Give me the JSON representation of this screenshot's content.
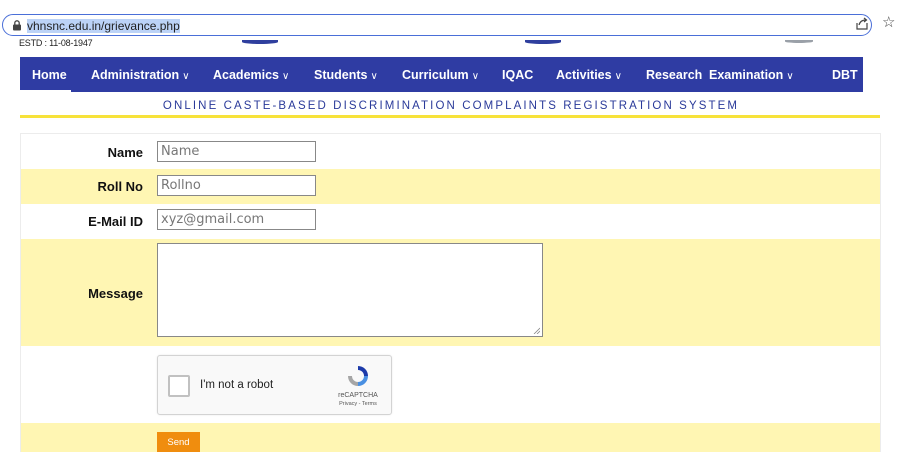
{
  "browser": {
    "url": "vhnsnc.edu.in/grievance.php"
  },
  "header": {
    "estd": "ESTD : 11-08-1947"
  },
  "nav": {
    "items": [
      {
        "label": "Home",
        "dropdown": false
      },
      {
        "label": "Administration",
        "dropdown": true
      },
      {
        "label": "Academics",
        "dropdown": true
      },
      {
        "label": "Students",
        "dropdown": true
      },
      {
        "label": "Curriculum",
        "dropdown": true
      },
      {
        "label": "IQAC",
        "dropdown": false
      },
      {
        "label": "Activities",
        "dropdown": true
      },
      {
        "label": "Research",
        "dropdown": false
      },
      {
        "label": "Examination",
        "dropdown": true
      },
      {
        "label": "DBT",
        "dropdown": false
      }
    ],
    "chevron": "∨"
  },
  "page": {
    "title": "ONLINE CASTE-BASED DISCRIMINATION COMPLAINTS REGISTRATION SYSTEM"
  },
  "form": {
    "name_label": "Name",
    "name_placeholder": "Name",
    "rollno_label": "Roll No",
    "rollno_placeholder": "Rollno",
    "email_label": "E-Mail ID",
    "email_placeholder": "xyz@gmail.com",
    "message_label": "Message",
    "captcha_text": "I'm not a robot",
    "captcha_brand": "reCAPTCHA",
    "captcha_terms": "Privacy - Terms",
    "send_label": "Send"
  },
  "colors": {
    "nav_bg": "#2f3ca3",
    "title_color": "#2a3a9a",
    "rule_yellow": "#f7e23a",
    "row_yellow": "#fff6b3",
    "send_orange": "#f08d0e"
  }
}
